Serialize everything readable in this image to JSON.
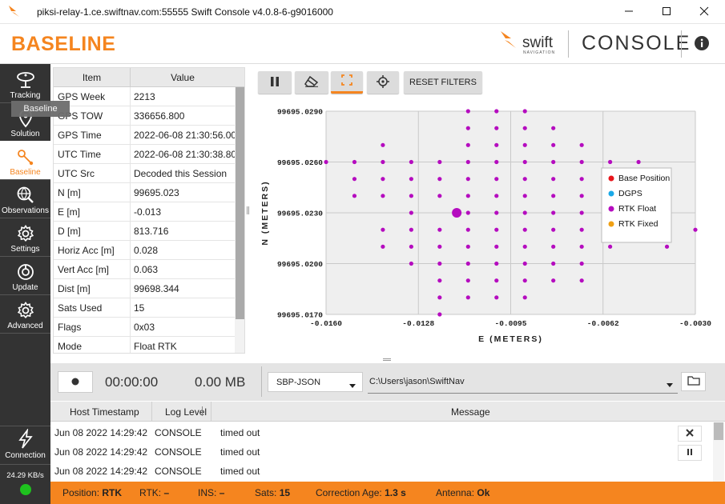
{
  "window": {
    "title": "piksi-relay-1.ce.swiftnav.com:55555 Swift Console v4.0.8-6-g9016000",
    "minimize_icon": "minimize-icon",
    "maximize_icon": "maximize-icon",
    "close_icon": "close-icon"
  },
  "header": {
    "page_title": "BASELINE",
    "logo_word": "swift",
    "logo_sub": "NAVIGATION",
    "product": "CONSOLE",
    "info_icon": "info-icon",
    "accent_color": "#f5851f"
  },
  "sidebar": {
    "items": [
      {
        "label": "Tracking",
        "icon": "satellite-dish-icon"
      },
      {
        "label": "Solution",
        "icon": "map-pin-icon"
      },
      {
        "label": "Baseline",
        "icon": "baseline-icon",
        "active": true
      },
      {
        "label": "Observations",
        "icon": "globe-search-icon"
      },
      {
        "label": "Settings",
        "icon": "gear-icon"
      },
      {
        "label": "Update",
        "icon": "update-icon"
      },
      {
        "label": "Advanced",
        "icon": "advanced-gear-icon"
      }
    ],
    "tooltip": "Baseline",
    "connection_label": "Connection",
    "data_rate": "24.29 KB/s",
    "connected_color": "#1ec21e"
  },
  "table": {
    "headers": {
      "item": "Item",
      "value": "Value"
    },
    "rows": [
      {
        "item": "GPS Week",
        "value": "2213"
      },
      {
        "item": "GPS TOW",
        "value": "336656.800"
      },
      {
        "item": "GPS Time",
        "value": "2022-06-08 21:30:56.000"
      },
      {
        "item": "UTC Time",
        "value": "2022-06-08 21:30:38.800"
      },
      {
        "item": "UTC Src",
        "value": "Decoded this Session"
      },
      {
        "item": "N [m]",
        "value": "99695.023"
      },
      {
        "item": "E [m]",
        "value": "-0.013"
      },
      {
        "item": "D [m]",
        "value": "813.716"
      },
      {
        "item": "Horiz Acc [m]",
        "value": "0.028"
      },
      {
        "item": "Vert Acc [m]",
        "value": "0.063"
      },
      {
        "item": "Dist [m]",
        "value": "99698.344"
      },
      {
        "item": "Sats Used",
        "value": "15"
      },
      {
        "item": "Flags",
        "value": "0x03"
      },
      {
        "item": "Mode",
        "value": "Float RTK"
      }
    ]
  },
  "toolbar": {
    "pause_icon": "pause-icon",
    "clear_icon": "eraser-icon",
    "zoom_icon": "zoom-fit-icon",
    "center_icon": "crosshair-icon",
    "reset_label": "RESET FILTERS"
  },
  "chart_data": {
    "type": "scatter",
    "xlabel": "E (METERS)",
    "ylabel": "N (METERS)",
    "xlim": [
      -0.016,
      -0.003
    ],
    "ylim": [
      99695.017,
      99695.029
    ],
    "x_ticks": [
      "-0.0160",
      "-0.0128",
      "-0.0095",
      "-0.0062",
      "-0.0030"
    ],
    "y_ticks": [
      "99695.0290",
      "99695.0260",
      "99695.0230",
      "99695.0200",
      "99695.0170"
    ],
    "grid": true,
    "legend_position": "right",
    "legend": [
      {
        "name": "Base Position",
        "color": "#e8151b"
      },
      {
        "name": "DGPS",
        "color": "#1aa9e8"
      },
      {
        "name": "RTK Float",
        "color": "#b50cbf"
      },
      {
        "name": "RTK Fixed",
        "color": "#f0a014"
      }
    ],
    "series": [
      {
        "name": "RTK Float",
        "color": "#b50cbf",
        "points": [
          [
            -0.016,
            99695.026
          ],
          [
            -0.015,
            99695.026
          ],
          [
            -0.015,
            99695.025
          ],
          [
            -0.015,
            99695.024
          ],
          [
            -0.014,
            99695.027
          ],
          [
            -0.014,
            99695.026
          ],
          [
            -0.014,
            99695.025
          ],
          [
            -0.014,
            99695.024
          ],
          [
            -0.014,
            99695.022
          ],
          [
            -0.014,
            99695.021
          ],
          [
            -0.013,
            99695.026
          ],
          [
            -0.013,
            99695.025
          ],
          [
            -0.013,
            99695.024
          ],
          [
            -0.013,
            99695.023
          ],
          [
            -0.013,
            99695.022
          ],
          [
            -0.013,
            99695.021
          ],
          [
            -0.013,
            99695.02
          ],
          [
            -0.012,
            99695.026
          ],
          [
            -0.012,
            99695.025
          ],
          [
            -0.012,
            99695.024
          ],
          [
            -0.012,
            99695.022
          ],
          [
            -0.012,
            99695.021
          ],
          [
            -0.012,
            99695.02
          ],
          [
            -0.012,
            99695.019
          ],
          [
            -0.012,
            99695.018
          ],
          [
            -0.012,
            99695.017
          ],
          [
            -0.011,
            99695.029
          ],
          [
            -0.011,
            99695.028
          ],
          [
            -0.011,
            99695.027
          ],
          [
            -0.011,
            99695.026
          ],
          [
            -0.011,
            99695.025
          ],
          [
            -0.011,
            99695.024
          ],
          [
            -0.011,
            99695.023
          ],
          [
            -0.011,
            99695.022
          ],
          [
            -0.011,
            99695.021
          ],
          [
            -0.011,
            99695.02
          ],
          [
            -0.011,
            99695.019
          ],
          [
            -0.011,
            99695.018
          ],
          [
            -0.01,
            99695.029
          ],
          [
            -0.01,
            99695.028
          ],
          [
            -0.01,
            99695.027
          ],
          [
            -0.01,
            99695.026
          ],
          [
            -0.01,
            99695.025
          ],
          [
            -0.01,
            99695.024
          ],
          [
            -0.01,
            99695.023
          ],
          [
            -0.01,
            99695.022
          ],
          [
            -0.01,
            99695.021
          ],
          [
            -0.01,
            99695.02
          ],
          [
            -0.01,
            99695.019
          ],
          [
            -0.01,
            99695.018
          ],
          [
            -0.009,
            99695.029
          ],
          [
            -0.009,
            99695.028
          ],
          [
            -0.009,
            99695.027
          ],
          [
            -0.009,
            99695.026
          ],
          [
            -0.009,
            99695.025
          ],
          [
            -0.009,
            99695.024
          ],
          [
            -0.009,
            99695.023
          ],
          [
            -0.009,
            99695.022
          ],
          [
            -0.009,
            99695.021
          ],
          [
            -0.009,
            99695.02
          ],
          [
            -0.009,
            99695.019
          ],
          [
            -0.009,
            99695.018
          ],
          [
            -0.008,
            99695.028
          ],
          [
            -0.008,
            99695.027
          ],
          [
            -0.008,
            99695.026
          ],
          [
            -0.008,
            99695.025
          ],
          [
            -0.008,
            99695.024
          ],
          [
            -0.008,
            99695.023
          ],
          [
            -0.008,
            99695.022
          ],
          [
            -0.008,
            99695.021
          ],
          [
            -0.008,
            99695.02
          ],
          [
            -0.008,
            99695.019
          ],
          [
            -0.007,
            99695.027
          ],
          [
            -0.007,
            99695.026
          ],
          [
            -0.007,
            99695.025
          ],
          [
            -0.007,
            99695.024
          ],
          [
            -0.007,
            99695.023
          ],
          [
            -0.007,
            99695.022
          ],
          [
            -0.007,
            99695.021
          ],
          [
            -0.007,
            99695.02
          ],
          [
            -0.007,
            99695.019
          ],
          [
            -0.006,
            99695.026
          ],
          [
            -0.006,
            99695.021
          ],
          [
            -0.005,
            99695.026
          ],
          [
            -0.004,
            99695.021
          ],
          [
            -0.003,
            99695.022
          ]
        ],
        "current": [
          -0.0114,
          99695.023
        ]
      }
    ]
  },
  "recorder": {
    "record_icon": "record-icon",
    "elapsed": "00:00:00",
    "size": "0.00 MB",
    "format": "SBP-JSON",
    "path": "C:\\Users\\jason\\SwiftNav",
    "folder_icon": "folder-icon"
  },
  "log": {
    "headers": {
      "timestamp": "Host Timestamp",
      "level": "Log Level",
      "message": "Message"
    },
    "rows": [
      {
        "timestamp": "Jun 08 2022 14:29:42",
        "level": "CONSOLE",
        "message": "timed out"
      },
      {
        "timestamp": "Jun 08 2022 14:29:42",
        "level": "CONSOLE",
        "message": "timed out"
      },
      {
        "timestamp": "Jun 08 2022 14:29:42",
        "level": "CONSOLE",
        "message": "timed out"
      }
    ],
    "clear_icon": "close-icon",
    "pause_icon": "pause-icon"
  },
  "status": {
    "position_label": "Position:",
    "position": "RTK",
    "rtk_label": "RTK:",
    "rtk": "–",
    "ins_label": "INS:",
    "ins": "–",
    "sats_label": "Sats:",
    "sats": "15",
    "corr_label": "Correction Age:",
    "corr": "1.3 s",
    "antenna_label": "Antenna:",
    "antenna": "Ok"
  }
}
